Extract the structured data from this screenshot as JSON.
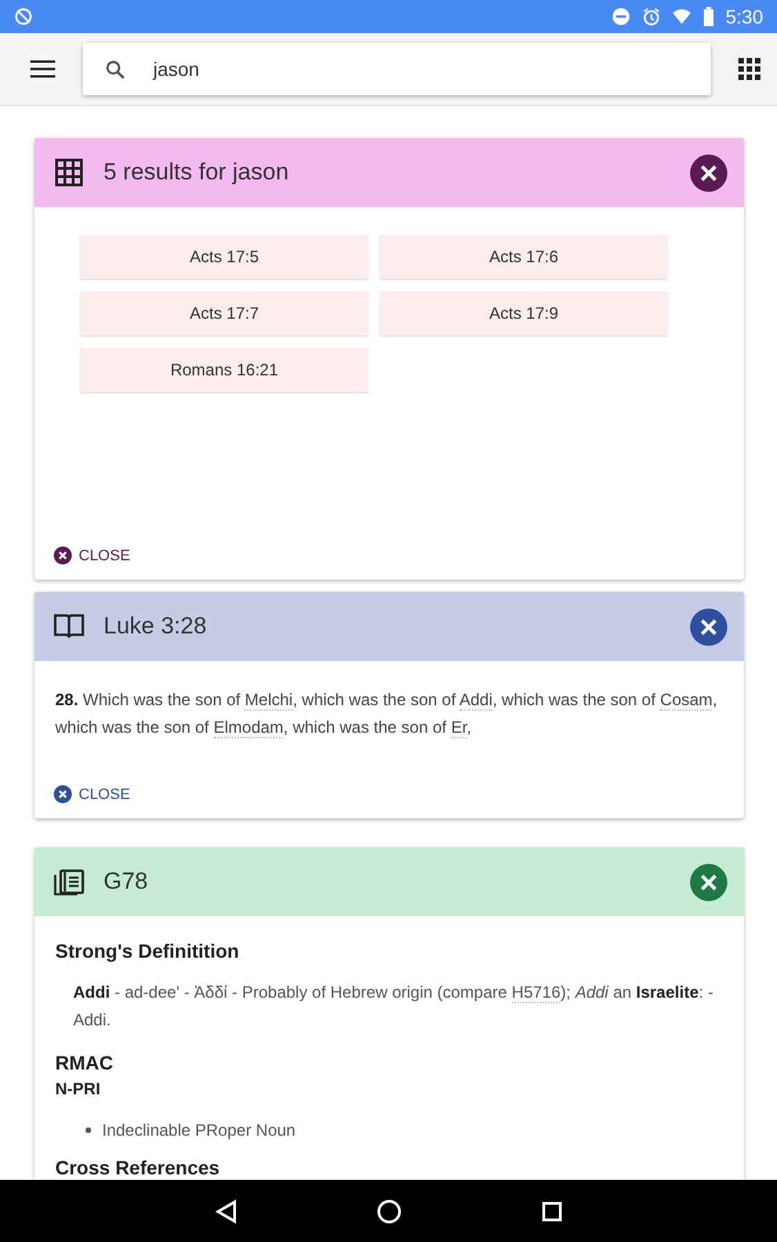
{
  "status_bar": {
    "time": "5:30"
  },
  "search": {
    "value": "jason"
  },
  "cards": [
    {
      "kind": "results",
      "title": "5 results for jason",
      "color": "#f3baf0",
      "results": [
        "Acts 17:5",
        "Acts 17:6",
        "Acts 17:7",
        "Acts 17:9",
        "Romans 16:21"
      ],
      "close_label": "CLOSE"
    },
    {
      "kind": "verse",
      "title": "Luke 3:28",
      "color": "#c5cde6",
      "verse_number": "28.",
      "segments": [
        {
          "text": "Which was the son of ",
          "link": false
        },
        {
          "text": "Melchi",
          "link": true
        },
        {
          "text": ", which was the son of ",
          "link": false
        },
        {
          "text": "Addi",
          "link": true
        },
        {
          "text": ", which was the son of ",
          "link": false
        },
        {
          "text": "Cosam",
          "link": true
        },
        {
          "text": ", which was the son of ",
          "link": false
        },
        {
          "text": "Elmodam",
          "link": true
        },
        {
          "text": ", which was the son of ",
          "link": false
        },
        {
          "text": "Er",
          "link": true
        },
        {
          "text": ",",
          "link": false
        }
      ],
      "close_label": "CLOSE"
    },
    {
      "kind": "strongs",
      "title": "G78",
      "color": "#c5ecd2",
      "sections": [
        {
          "heading": "Strong's Definitition",
          "segments": [
            {
              "text": "**Addi** - ad-dee' - Ἀδδί - Probably of Hebrew origin (compare ",
              "link": false
            },
            {
              "text": "H5716",
              "link": true
            },
            {
              "text": "); *Addi* an **Israelite**: - Addi.",
              "link": false
            }
          ]
        },
        {
          "heading": "RMAC",
          "code": "N-PRI",
          "bullets": [
            "Indeclinable PRoper Noun"
          ]
        },
        {
          "heading": "Cross References"
        }
      ]
    }
  ]
}
